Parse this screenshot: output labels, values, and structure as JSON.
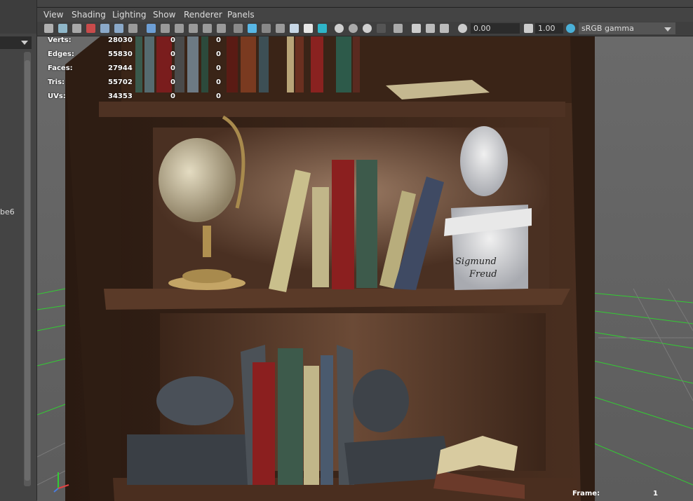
{
  "left_panel": {
    "label": "be6"
  },
  "menubar": {
    "items": [
      "View",
      "Shading",
      "Lighting",
      "Show",
      "Renderer",
      "Panels"
    ]
  },
  "toolbar": {
    "exposure": "0.00",
    "gamma": "1.00",
    "colorspace": "sRGB gamma"
  },
  "hud": {
    "rows": [
      {
        "label": "Verts:",
        "v1": "28030",
        "v2": "0",
        "v3": "0"
      },
      {
        "label": "Edges:",
        "v1": "55830",
        "v2": "0",
        "v3": "0"
      },
      {
        "label": "Faces:",
        "v1": "27944",
        "v2": "0",
        "v3": "0"
      },
      {
        "label": "Tris:",
        "v1": "55702",
        "v2": "0",
        "v3": "0"
      },
      {
        "label": "UVs:",
        "v1": "34353",
        "v2": "0",
        "v3": "0"
      }
    ],
    "frame_label": "Frame:",
    "frame_value": "1"
  },
  "scene": {
    "bust_inscription_line1": "Sigmund",
    "bust_inscription_line2": "Freud"
  },
  "colors": {
    "grid": "#33cc33",
    "wood_dark": "#3a2417",
    "wood_light": "#6b4631",
    "background": "#6d6d6d"
  }
}
